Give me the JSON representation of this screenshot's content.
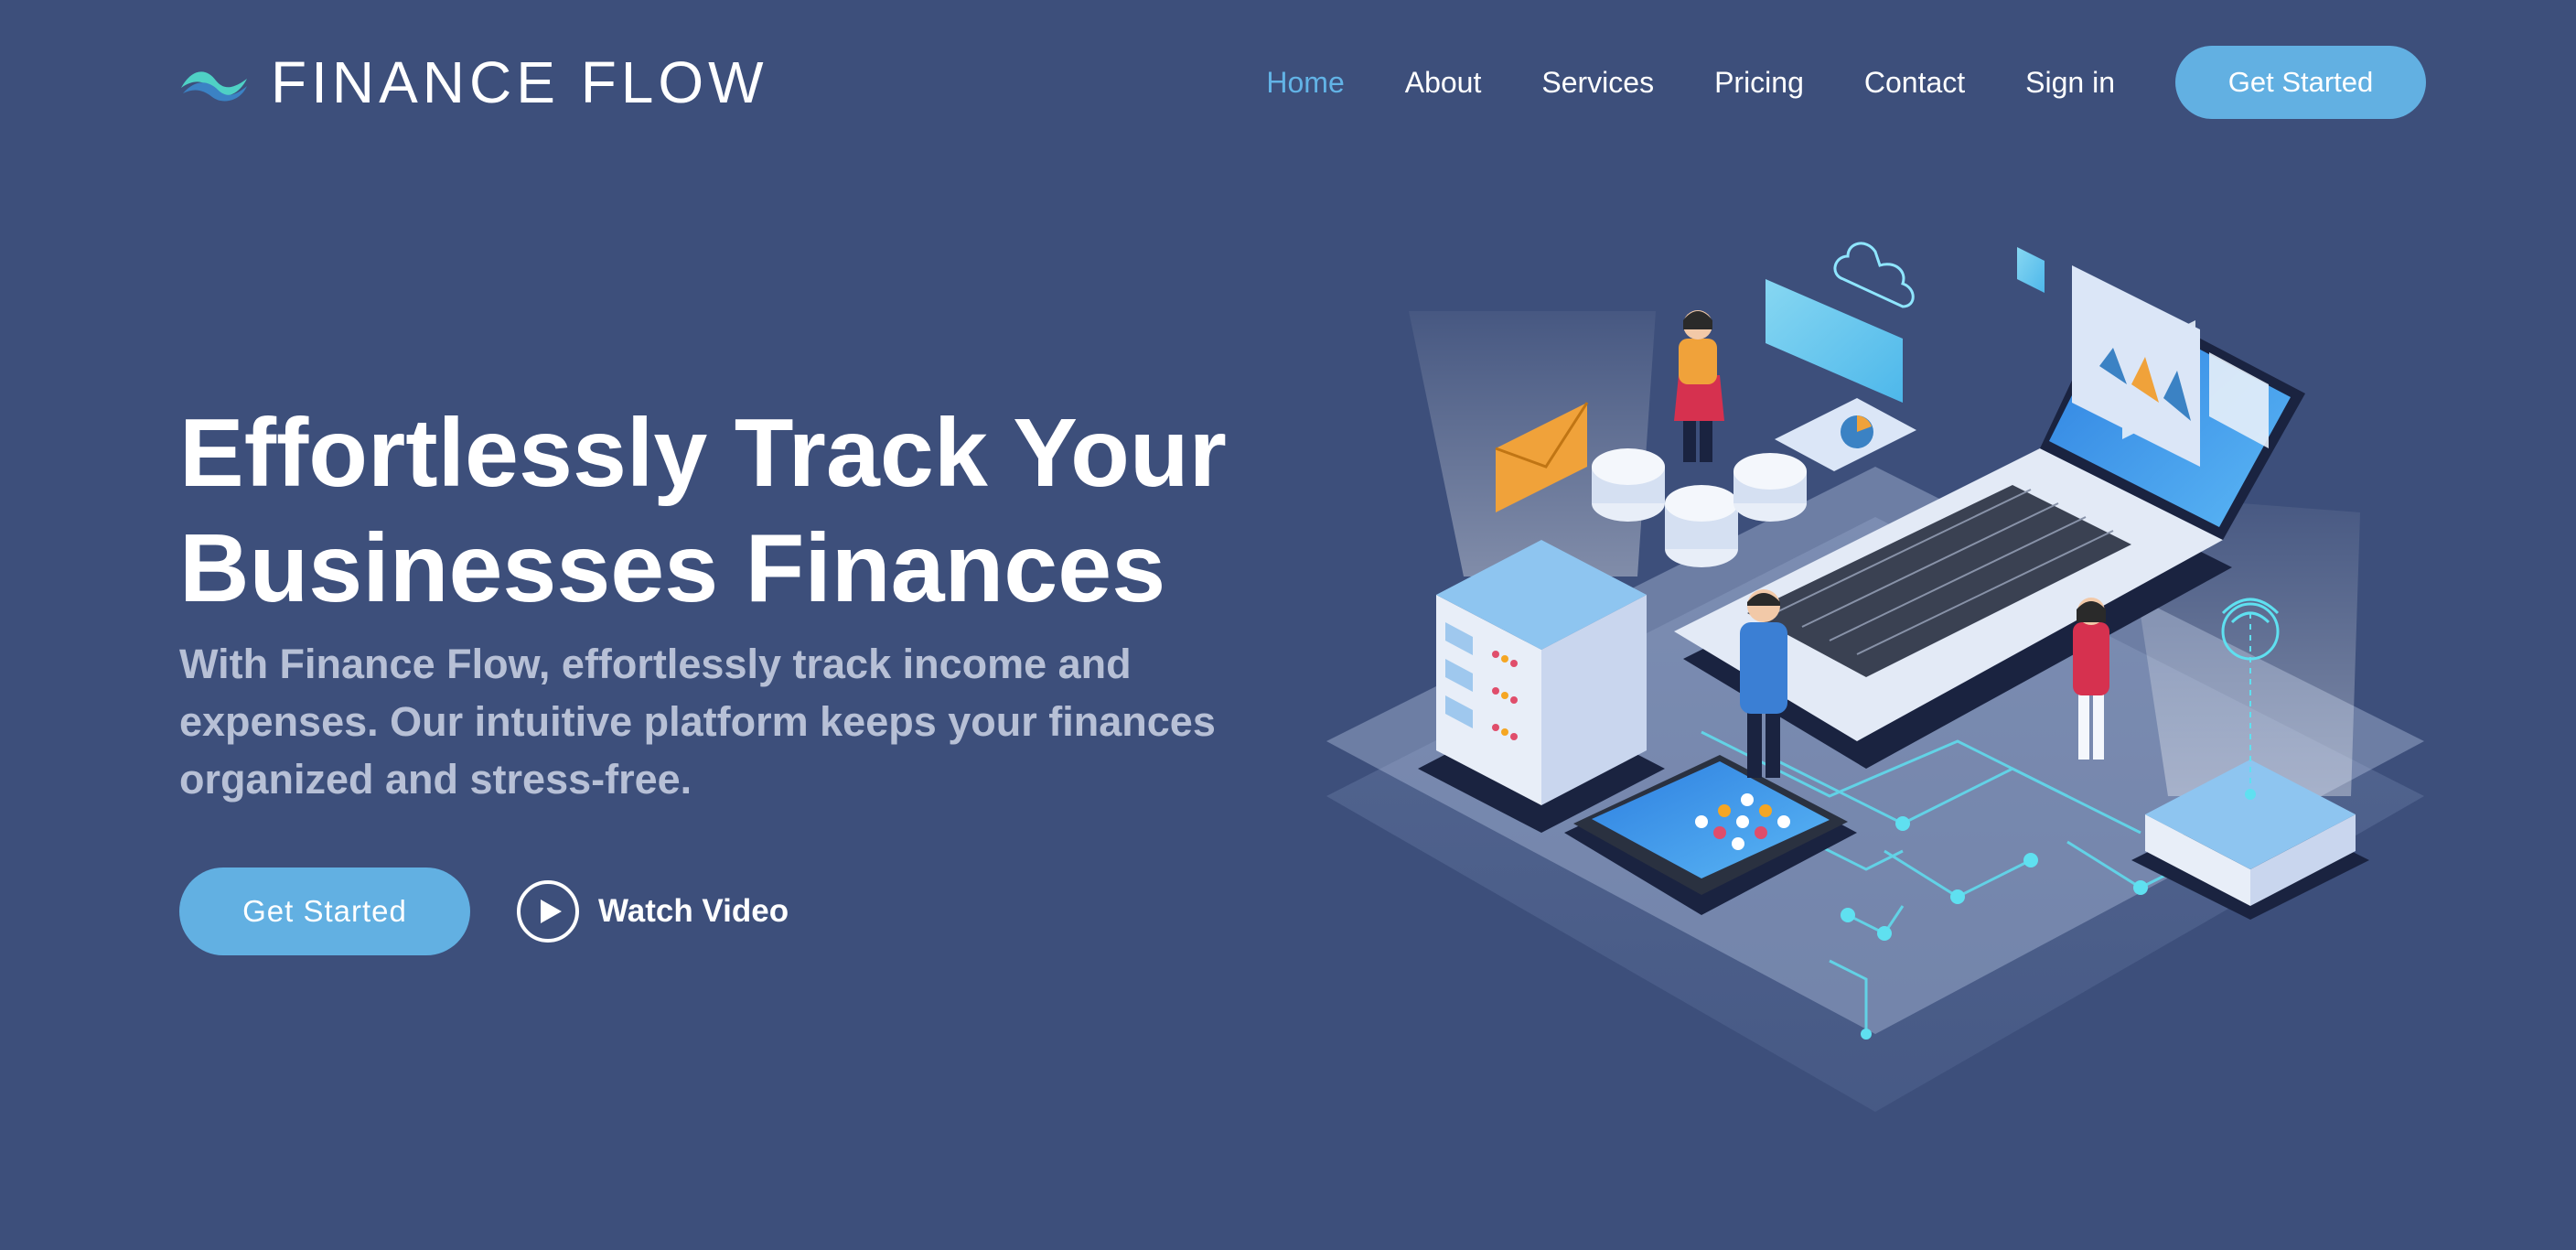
{
  "brand": {
    "name": "FINANCE FLOW",
    "logo_icon": "wave-logo-icon"
  },
  "nav": {
    "items": [
      {
        "label": "Home",
        "active": true
      },
      {
        "label": "About",
        "active": false
      },
      {
        "label": "Services",
        "active": false
      },
      {
        "label": "Pricing",
        "active": false
      },
      {
        "label": "Contact",
        "active": false
      },
      {
        "label": "Sign in",
        "active": false
      }
    ],
    "cta_label": "Get Started"
  },
  "hero": {
    "title_line1": "Effortlessly Track Your",
    "title_line2": "Businesses Finances",
    "subtitle": "With Finance Flow, effortlessly track income and expenses. Our intuitive platform keeps your finances organized and stress-free.",
    "cta_label": "Get Started",
    "video_label": "Watch Video",
    "video_icon": "play-circle-icon"
  },
  "colors": {
    "background": "#3d4f7b",
    "accent": "#62b0e2",
    "nav_active": "#62b3e6",
    "subtitle": "#b7c0d6"
  }
}
